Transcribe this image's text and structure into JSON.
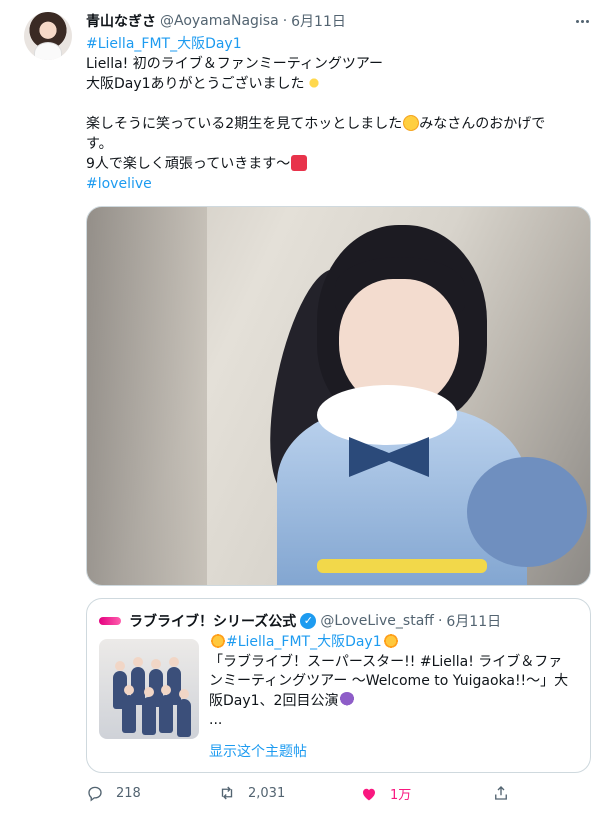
{
  "tweet": {
    "display_name": "青山なぎさ",
    "handle": "@AoyamaNagisa",
    "separator": "·",
    "date": "6月11日",
    "more_icon": "more-horizontal-icon",
    "lines": {
      "hashtag1": "#Liella_FMT_大阪Day1",
      "line2": "Liella! 初のライブ＆ファンミーティングツアー",
      "line3": "大阪Day1ありがとうございました",
      "line5": "楽しそうに笑っている2期生を見てホッとしました",
      "line5b": "みなさんのおかげで",
      "line6": "す。",
      "line7": "9人で楽しく頑張っていきます〜",
      "hashtag2": "#lovelive"
    },
    "photo_alt": "photo"
  },
  "quote": {
    "display_name": "ラブライブ！シリーズ公式",
    "verified": "✓",
    "handle": "@LoveLive_staff",
    "separator": "·",
    "date": "6月11日",
    "hashtag": "#Liella_FMT_大阪Day1",
    "line2": "「ラブライブ！スーパースター!! #Liella! ライブ＆ファ",
    "line3": "ンミーティングツアー ～Welcome to Yuigaoka!!～」大",
    "line4": "阪Day1、2回目公演",
    "ellipsis": "...",
    "show_thread": "显示这个主题帖"
  },
  "actions": {
    "reply_count": "218",
    "retweet_count": "2,031",
    "like_count": "1万",
    "reply_icon": "reply-icon",
    "retweet_icon": "retweet-icon",
    "like_icon": "heart-icon",
    "share_icon": "share-icon"
  },
  "colors": {
    "link": "#1d9bf0",
    "secondary_text": "#536471",
    "like": "#f91880",
    "border": "#cfd9de"
  }
}
